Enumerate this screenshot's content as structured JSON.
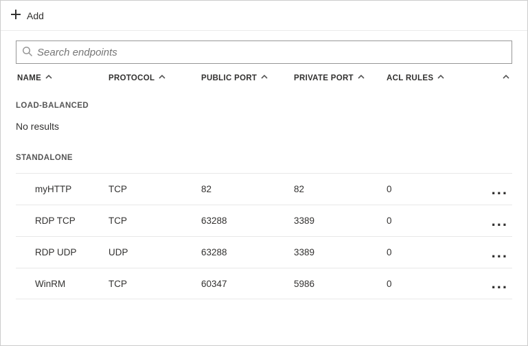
{
  "toolbar": {
    "add_label": "Add"
  },
  "search": {
    "placeholder": "Search endpoints"
  },
  "columns": {
    "name": "NAME",
    "protocol": "PROTOCOL",
    "public_port": "PUBLIC PORT",
    "private_port": "PRIVATE PORT",
    "acl_rules": "ACL RULES"
  },
  "sections": {
    "load_balanced": {
      "label": "LOAD-BALANCED",
      "empty_text": "No results",
      "rows": []
    },
    "standalone": {
      "label": "STANDALONE",
      "rows": [
        {
          "name": "myHTTP",
          "protocol": "TCP",
          "public_port": "82",
          "private_port": "82",
          "acl_rules": "0"
        },
        {
          "name": "RDP TCP",
          "protocol": "TCP",
          "public_port": "63288",
          "private_port": "3389",
          "acl_rules": "0"
        },
        {
          "name": "RDP UDP",
          "protocol": "UDP",
          "public_port": "63288",
          "private_port": "3389",
          "acl_rules": "0"
        },
        {
          "name": "WinRM",
          "protocol": "TCP",
          "public_port": "60347",
          "private_port": "5986",
          "acl_rules": "0"
        }
      ]
    }
  }
}
